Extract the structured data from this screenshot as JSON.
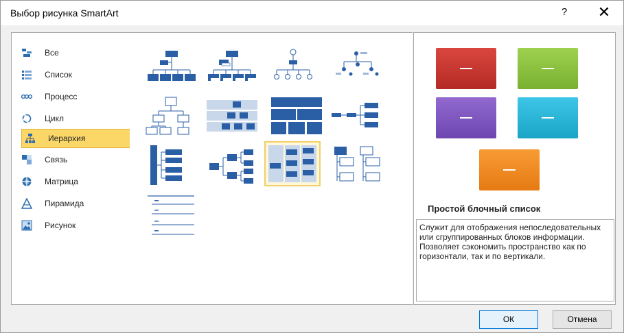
{
  "window": {
    "title": "Выбор рисунка SmartArt",
    "help_label": "?",
    "close_label": "✕"
  },
  "categories": [
    {
      "label": "Все",
      "icon": "all-icon",
      "selected": false
    },
    {
      "label": "Список",
      "icon": "list-icon",
      "selected": false
    },
    {
      "label": "Процесс",
      "icon": "process-icon",
      "selected": false
    },
    {
      "label": "Цикл",
      "icon": "cycle-icon",
      "selected": false
    },
    {
      "label": "Иерархия",
      "icon": "hierarchy-icon",
      "selected": true
    },
    {
      "label": "Связь",
      "icon": "relationship-icon",
      "selected": false
    },
    {
      "label": "Матрица",
      "icon": "matrix-icon",
      "selected": false
    },
    {
      "label": "Пирамида",
      "icon": "pyramid-icon",
      "selected": false
    },
    {
      "label": "Рисунок",
      "icon": "picture-icon",
      "selected": false
    }
  ],
  "preview": {
    "title": "Простой блочный список",
    "description": "Служит для отображения непоследовательных или сгруппированных блоков информации. Позволяет сэкономить пространство как по горизонтали, так и по вертикали.",
    "colors": [
      "#c9302c",
      "#8cc63f",
      "#7e57c2",
      "#29b6d8",
      "#f5891f"
    ]
  },
  "buttons": {
    "ok": "ОК",
    "cancel": "Отмена"
  }
}
